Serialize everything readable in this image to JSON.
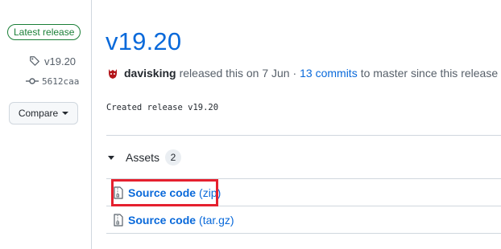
{
  "sidebar": {
    "latest_badge": "Latest release",
    "tag": "v19.20",
    "commit": "5612caa",
    "compare_label": "Compare"
  },
  "release": {
    "title": "v19.20",
    "author": "davisking",
    "released_text": "released this on 7 Jun ·",
    "commits_link": "13 commits",
    "to_master_text": "to master since this release",
    "body": "Created release v19.20"
  },
  "assets": {
    "label": "Assets",
    "count": "2",
    "items": [
      {
        "name": "Source code",
        "ext": "(zip)"
      },
      {
        "name": "Source code",
        "ext": "(tar.gz)"
      }
    ]
  },
  "colors": {
    "link": "#0969da",
    "success": "#1a7f37",
    "highlight": "#e5202e"
  }
}
